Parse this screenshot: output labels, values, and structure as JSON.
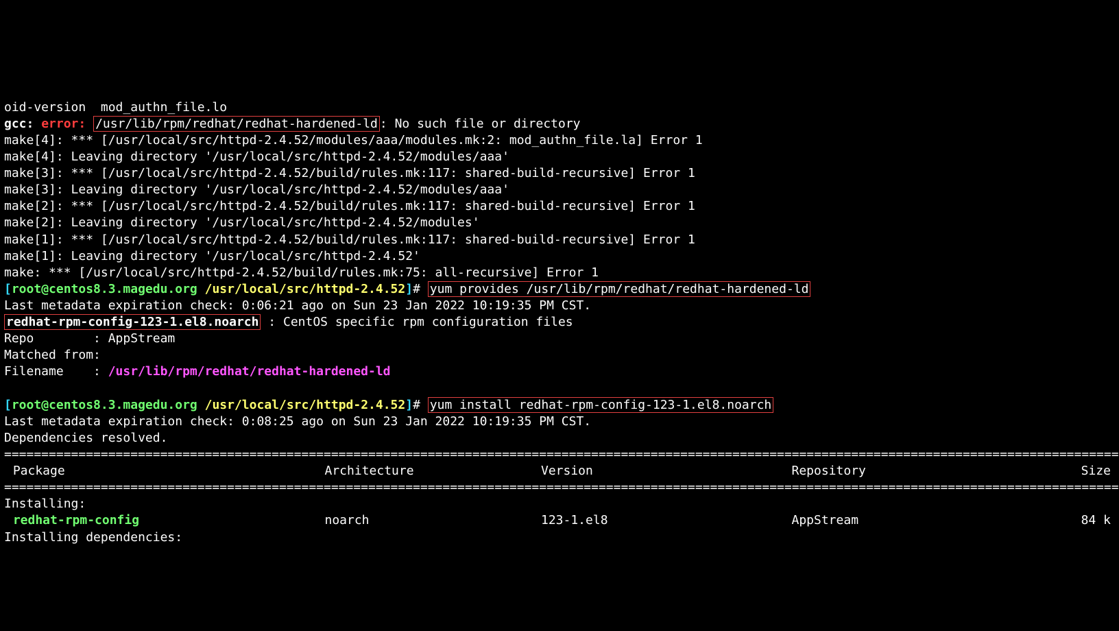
{
  "line0": "oid-version  mod_authn_file.lo",
  "gcc": {
    "prefix": "gcc:",
    "error": "error:",
    "path": "/usr/lib/rpm/redhat/redhat-hardened-ld",
    "suffix": ": No such file or directory"
  },
  "make_lines": [
    "make[4]: *** [/usr/local/src/httpd-2.4.52/modules/aaa/modules.mk:2: mod_authn_file.la] Error 1",
    "make[4]: Leaving directory '/usr/local/src/httpd-2.4.52/modules/aaa'",
    "make[3]: *** [/usr/local/src/httpd-2.4.52/build/rules.mk:117: shared-build-recursive] Error 1",
    "make[3]: Leaving directory '/usr/local/src/httpd-2.4.52/modules/aaa'",
    "make[2]: *** [/usr/local/src/httpd-2.4.52/build/rules.mk:117: shared-build-recursive] Error 1",
    "make[2]: Leaving directory '/usr/local/src/httpd-2.4.52/modules'",
    "make[1]: *** [/usr/local/src/httpd-2.4.52/build/rules.mk:117: shared-build-recursive] Error 1",
    "make[1]: Leaving directory '/usr/local/src/httpd-2.4.52'",
    "make: *** [/usr/local/src/httpd-2.4.52/build/rules.mk:75: all-recursive] Error 1"
  ],
  "prompt": {
    "open": "[",
    "user": "root@centos8.3.magedu.org",
    "cwd": "/usr/local/src/httpd-2.4.52",
    "close": "]",
    "hash": "# "
  },
  "cmd1": "yum provides /usr/lib/rpm/redhat/redhat-hardened-ld",
  "cmd1_out": {
    "l1": "Last metadata expiration check: 0:06:21 ago on Sun 23 Jan 2022 10:19:35 PM CST.",
    "pkg": "redhat-rpm-config-123-1.el8.noarch",
    "pkg_desc": " : CentOS specific rpm configuration files",
    "repo": "Repo        : AppStream",
    "matched": "Matched from:",
    "fn_lbl": "Filename    : ",
    "fn_val": "/usr/lib/rpm/redhat/redhat-hardened-ld"
  },
  "cmd2": "yum install redhat-rpm-config-123-1.el8.noarch",
  "cmd2_out": {
    "l1": "Last metadata expiration check: 0:08:25 ago on Sun 23 Jan 2022 10:19:35 PM CST.",
    "l2": "Dependencies resolved."
  },
  "hr": "==========================================================================================================================================================",
  "table": {
    "hdr": {
      "pkg": " Package",
      "arch": "Architecture",
      "ver": "Version",
      "repo": "Repository",
      "size": "Size"
    },
    "sect1": "Installing:",
    "row1": {
      "pkg": " redhat-rpm-config",
      "arch": "noarch",
      "ver": "123-1.el8",
      "repo": "AppStream",
      "size": "84 k"
    },
    "sect2": "Installing dependencies:"
  }
}
